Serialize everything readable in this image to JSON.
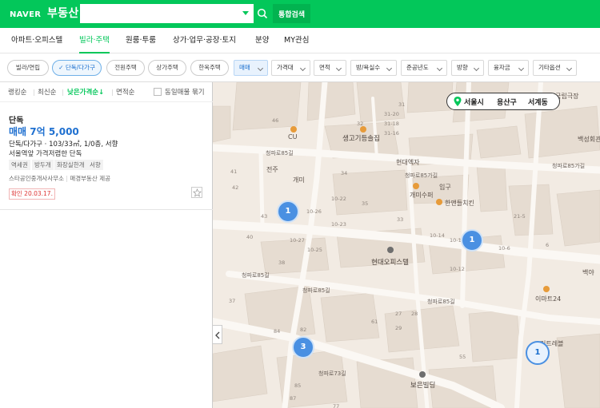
{
  "header": {
    "logo": "NAVER",
    "service": "부동산",
    "search_placeholder": "",
    "total_search": "통합검색"
  },
  "nav": {
    "items": [
      "아파트·오피스텔",
      "빌라·주택",
      "원룸·투룸",
      "상가·업무·공장·토지",
      "분양",
      "MY관심"
    ],
    "active": "빌라·주택"
  },
  "filters": {
    "chips": [
      "빌라/연립",
      "단독/다가구",
      "전원주택",
      "상가주택",
      "한옥주택"
    ],
    "selected_chip": "단독/다가구",
    "dropdowns": [
      "매매",
      "가격대",
      "면적",
      "방/욕실수",
      "준공년도",
      "방향",
      "융자금",
      "기타옵션"
    ],
    "selected_dropdown": "매매"
  },
  "sort": {
    "options": [
      "랭킹순",
      "최신순",
      "낮은가격순↓",
      "면적순"
    ],
    "active": "낮은가격순↓",
    "same_listing": "동일매물 묶기"
  },
  "listing": {
    "type": "단독",
    "price": "매매 7억 5,000",
    "spec": "단독/다가구 · 103/33㎡, 1/0층, 서향",
    "desc": "서울역앞 가격저렴한 단독",
    "tags": [
      "역세권",
      "방두개",
      "화장실한개",
      "서향"
    ],
    "agency": "스타공인중개사사무소",
    "provider": "매경부동산 제공",
    "confirm": "확인 20.03.17."
  },
  "location": {
    "city": "서울시",
    "district": "용산구",
    "dong": "서계동"
  },
  "map": {
    "places": [
      "CU",
      "생고기등솔집",
      "현대엑자",
      "전주",
      "개미",
      "개미수퍼",
      "한앤들치킨",
      "입구",
      "현대오피스텔",
      "이마트24",
      "보은빌딩",
      "국립극장",
      "백성회관 극장",
      "백야",
      "커트레블"
    ],
    "roads": [
      "청파로85길",
      "청파로85가길",
      "청파로85길",
      "청파로85길",
      "청파로73길",
      "청파로85길",
      "청파로85가길"
    ],
    "lot_numbers": [
      "46",
      "41",
      "42",
      "43",
      "40",
      "32",
      "33",
      "35",
      "34",
      "31",
      "31-20",
      "31-18",
      "31-16",
      "10-26",
      "10-27",
      "10-25",
      "10-14",
      "10-13",
      "10-12",
      "10-6",
      "10-22",
      "10-23",
      "38",
      "37",
      "82",
      "84",
      "85",
      "87",
      "77",
      "61",
      "55",
      "27",
      "28",
      "29",
      "6",
      "21-5"
    ],
    "clusters": [
      {
        "count": "1",
        "style": "filled"
      },
      {
        "count": "1",
        "style": "filled"
      },
      {
        "count": "3",
        "style": "filled"
      },
      {
        "count": "1",
        "style": "outline"
      }
    ]
  }
}
